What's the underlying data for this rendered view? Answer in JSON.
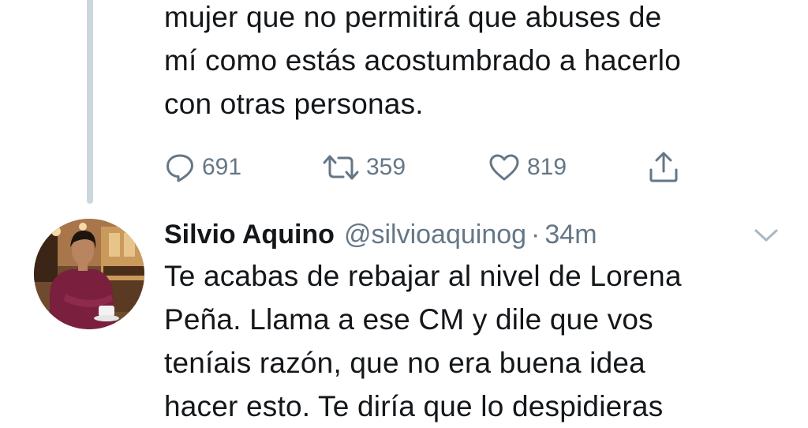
{
  "previous_tweet": {
    "text_lines": "mujer que no permitirá que abuses de\nmí como estás acostumbrado a hacerlo\ncon otras personas.",
    "reply_count": "691",
    "retweet_count": "359",
    "like_count": "819",
    "icons": {
      "reply": "speech-bubble-icon",
      "retweet": "retweet-arrows-icon",
      "like": "heart-icon",
      "share": "share-upload-icon"
    }
  },
  "reply_tweet": {
    "display_name": "Silvio Aquino",
    "handle": "@silvioaquinog",
    "separator": "·",
    "time": "34m",
    "text": "Te acabas de rebajar al nivel de Lorena\nPeña. Llama a ese CM y dile que vos\nteníais razón, que no era buena idea\nhacer esto. Te diría que lo despidieras",
    "avatar": "profile-photo",
    "menu_icon": "chevron-down-icon"
  },
  "colors": {
    "text": "#14171a",
    "secondary": "#657786",
    "thread_line": "#ccd6dd",
    "background": "#ffffff"
  }
}
